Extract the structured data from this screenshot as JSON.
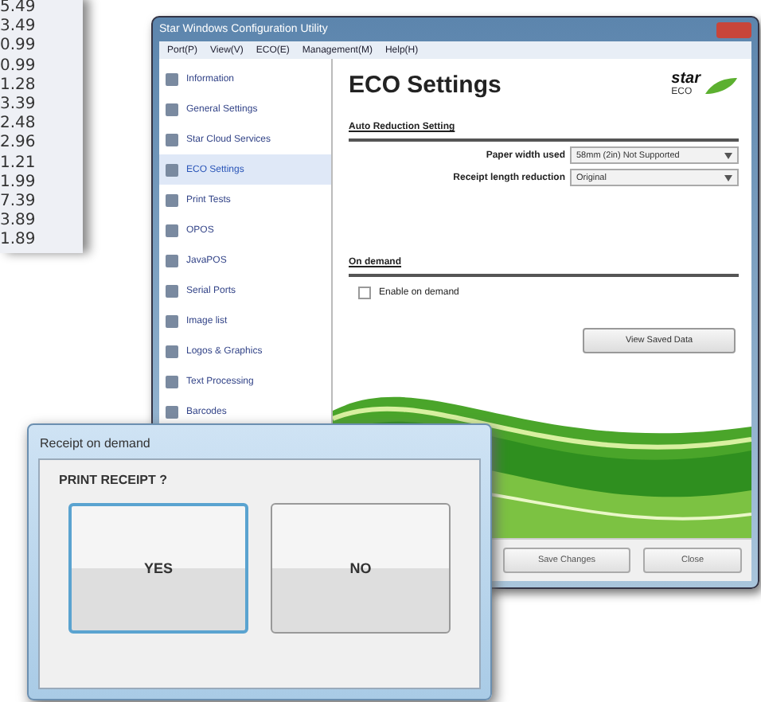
{
  "price_list": {
    "values": [
      "5.49",
      "3.49",
      "0.99",
      "0.99",
      "1.28",
      "3.39",
      "2.48",
      "2.96",
      "1.21",
      "1.99",
      "7.39",
      "3.89",
      "1.89"
    ]
  },
  "main_window": {
    "title": "Star Windows Configuration Utility",
    "menu": [
      "Port(P)",
      "View(V)",
      "ECO(E)",
      "Management(M)",
      "Help(H)"
    ],
    "sidebar": {
      "items": [
        {
          "label": "Information",
          "selected": false
        },
        {
          "label": "General Settings",
          "selected": false
        },
        {
          "label": "Star Cloud Services",
          "selected": false
        },
        {
          "label": "ECO Settings",
          "selected": true
        },
        {
          "label": "Print Tests",
          "selected": false
        },
        {
          "label": "OPOS",
          "selected": false
        },
        {
          "label": "JavaPOS",
          "selected": false
        },
        {
          "label": "Serial Ports",
          "selected": false
        },
        {
          "label": "Image list",
          "selected": false
        },
        {
          "label": "Logos & Graphics",
          "selected": false
        },
        {
          "label": "Text Processing",
          "selected": false
        },
        {
          "label": "Barcodes",
          "selected": false
        }
      ]
    },
    "content": {
      "heading": "ECO Settings",
      "logo_text": "star",
      "logo_subtext": "ECO",
      "section_auto": "Auto Reduction Setting",
      "fields": [
        {
          "label": "Paper width used",
          "value": "58mm (2in) Not Supported"
        },
        {
          "label": "Receipt length reduction",
          "value": "Original"
        }
      ],
      "section_demand": "On demand",
      "enable_on_demand": {
        "label": "Enable on demand",
        "checked": false
      },
      "view_button": "View Saved Data"
    },
    "buttons": [
      "Save Changes",
      "Close"
    ]
  },
  "dialog": {
    "title": "Receipt on demand",
    "prompt": "PRINT RECEIPT ?",
    "buttons": [
      {
        "label": "YES",
        "selected": true
      },
      {
        "label": "NO",
        "selected": false
      }
    ]
  }
}
